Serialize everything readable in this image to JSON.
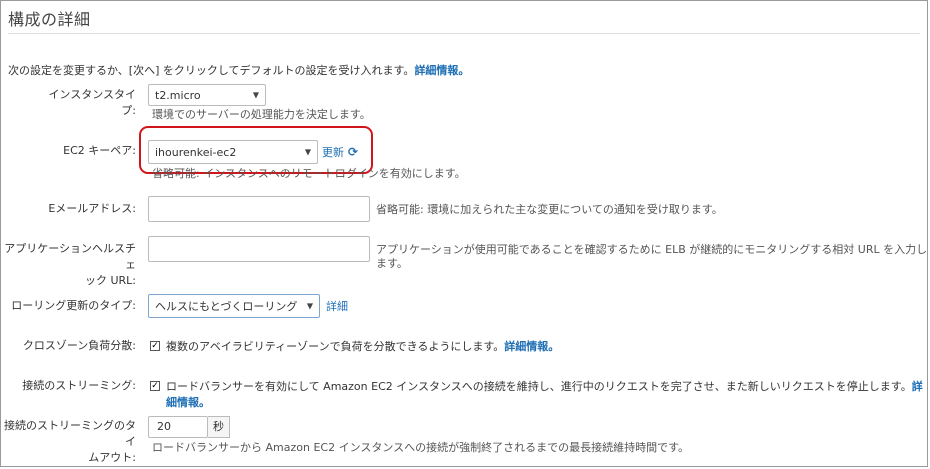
{
  "page": {
    "title": "構成の詳細",
    "intro": "次の設定を変更するか、[次へ] をクリックしてデフォルトの設定を受け入れます。",
    "intro_link": "詳細情報。"
  },
  "instance_type": {
    "label": "インスタンスタイプ:",
    "value": "t2.micro",
    "help": "環境でのサーバーの処理能力を決定します。"
  },
  "ec2_keypair": {
    "label": "EC2 キーペア:",
    "value": "ihourenkei-ec2",
    "refresh_label": "更新",
    "refresh_icon": "refresh-icon",
    "help": "省略可能: インスタンスへのリモートログインを有効にします。",
    "highlight_color": "#d0151b"
  },
  "email": {
    "label": "Eメールアドレス:",
    "value": "",
    "help": "省略可能: 環境に加えられた主な変更についての通知を受け取ります。"
  },
  "health_check": {
    "label_line1": "アプリケーションヘルスチェ",
    "label_line2": "ック URL:",
    "value": "",
    "help": "アプリケーションが使用可能であることを確認するために ELB が継続的にモニタリングする相対 URL を入力します。"
  },
  "rolling_update": {
    "label": "ローリング更新のタイプ:",
    "value": "ヘルスにもとづくローリング",
    "link": "詳細"
  },
  "cross_zone": {
    "label": "クロスゾーン負荷分散:",
    "checked": true,
    "text": "複数のアベイラビリティーゾーンで負荷を分散できるようにします。",
    "link": "詳細情報。"
  },
  "connection_draining": {
    "label": "接続のストリーミング:",
    "checked": true,
    "text": "ロードバランサーを有効にして Amazon EC2 インスタンスへの接続を維持し、進行中のリクエストを完了させ、また新しいリクエストを停止します。",
    "link": "詳細情報。"
  },
  "draining_timeout": {
    "label_line1": "接続のストリーミングのタイ",
    "label_line2": "ムアウト:",
    "value": "20",
    "unit": "秒",
    "help": "ロードバランサーから Amazon EC2 インスタンスへの接続が強制終了されるまでの最長接続維持時間です。"
  },
  "colors": {
    "link": "#1f6fb5",
    "border": "#bbb"
  }
}
